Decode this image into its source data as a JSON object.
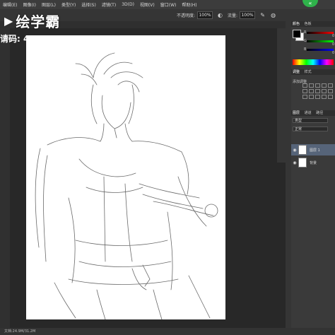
{
  "menubar": {
    "items": [
      "编辑(E)",
      "图像(I)",
      "图层(L)",
      "类型(Y)",
      "选择(S)",
      "滤镜(T)",
      "3D(D)",
      "视图(V)",
      "窗口(W)",
      "帮助(H)"
    ]
  },
  "options": {
    "opacity_label": "不透明度:",
    "opacity_value": "100%",
    "flow_label": "流量:",
    "flow_value": "100%"
  },
  "watermark": {
    "logo_text": "绘学霸",
    "invite_text": "请码: 4"
  },
  "panel": {
    "color_tabs": [
      "颜色",
      "色板"
    ],
    "slider_values": [
      "0",
      "0",
      "0"
    ],
    "adjust_tabs": [
      "调整",
      "样式"
    ],
    "adjust_label": "添加调整",
    "layer_tabs": [
      "图层",
      "通道",
      "路径"
    ],
    "filter_kind": "类型",
    "blend_mode": "正常",
    "layers": [
      {
        "name": "图层 1",
        "selected": true
      },
      {
        "name": "背景",
        "selected": false
      }
    ]
  },
  "status": {
    "doc_text": "文档:24.9M/31.2M"
  },
  "colors": {
    "accent_green": "#2fb24b",
    "selected_layer": "#566479"
  }
}
